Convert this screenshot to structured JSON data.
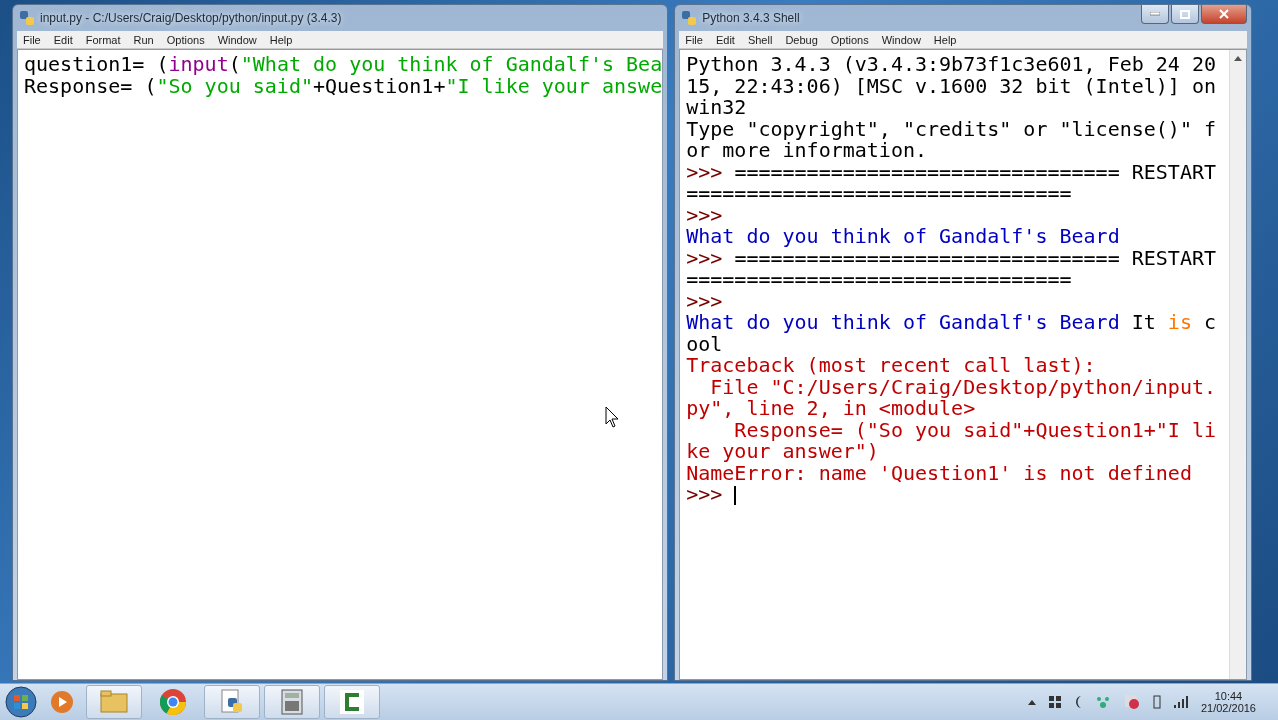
{
  "editor": {
    "title": "input.py - C:/Users/Craig/Desktop/python/input.py (3.4.3)",
    "menu": [
      "File",
      "Edit",
      "Format",
      "Run",
      "Options",
      "Window",
      "Help"
    ],
    "lines": [
      [
        {
          "text": "question1= (",
          "kind": "plain"
        },
        {
          "text": "input",
          "kind": "builtin"
        },
        {
          "text": "(",
          "kind": "plain"
        },
        {
          "text": "\"What do you think of Gandalf's Bea",
          "kind": "string"
        }
      ],
      [
        {
          "text": "Response= (",
          "kind": "plain"
        },
        {
          "text": "\"So you said\"",
          "kind": "string"
        },
        {
          "text": "+Question1+",
          "kind": "plain"
        },
        {
          "text": "\"I like your answe",
          "kind": "string"
        }
      ]
    ]
  },
  "shell": {
    "title": "Python 3.4.3 Shell",
    "menu": [
      "File",
      "Edit",
      "Shell",
      "Debug",
      "Options",
      "Window",
      "Help"
    ],
    "cursor": true,
    "lines": [
      [
        {
          "text": "Python 3.4.3 (v3.4.3:9b73f1c3e601, Feb 24 20",
          "kind": "plain"
        }
      ],
      [
        {
          "text": "15, 22:43:06) [MSC v.1600 32 bit (Intel)] on",
          "kind": "plain"
        }
      ],
      [
        {
          "text": "win32",
          "kind": "plain"
        }
      ],
      [
        {
          "text": "Type \"copyright\", \"credits\" or \"license()\" f",
          "kind": "plain"
        }
      ],
      [
        {
          "text": "or more information.",
          "kind": "plain"
        }
      ],
      [
        {
          "text": ">>> ",
          "kind": "prompt"
        },
        {
          "text": "================================ RESTART",
          "kind": "plain"
        }
      ],
      [
        {
          "text": "================================",
          "kind": "plain"
        }
      ],
      [
        {
          "text": ">>> ",
          "kind": "prompt"
        }
      ],
      [
        {
          "text": "What do you think of Gandalf's Beard",
          "kind": "output"
        }
      ],
      [
        {
          "text": ">>> ",
          "kind": "prompt"
        },
        {
          "text": "================================ RESTART",
          "kind": "plain"
        }
      ],
      [
        {
          "text": "================================",
          "kind": "plain"
        }
      ],
      [
        {
          "text": ">>> ",
          "kind": "prompt"
        }
      ],
      [
        {
          "text": "What do you think of Gandalf's Beard",
          "kind": "output"
        },
        {
          "text": " It ",
          "kind": "plain"
        },
        {
          "text": "is",
          "kind": "keyword"
        },
        {
          "text": " c",
          "kind": "plain"
        }
      ],
      [
        {
          "text": "ool",
          "kind": "plain"
        }
      ],
      [
        {
          "text": "Traceback (most recent call last):",
          "kind": "error"
        }
      ],
      [
        {
          "text": "  File \"C:/Users/Craig/Desktop/python/input.",
          "kind": "error"
        }
      ],
      [
        {
          "text": "py\", line 2, in <module>",
          "kind": "error"
        }
      ],
      [
        {
          "text": "    Response= (\"So you said\"+Question1+\"I li",
          "kind": "error"
        }
      ],
      [
        {
          "text": "ke your answer\")",
          "kind": "error"
        }
      ],
      [
        {
          "text": "NameError: name 'Question1' is not defined",
          "kind": "error"
        }
      ],
      [
        {
          "text": ">>> ",
          "kind": "prompt"
        }
      ]
    ]
  },
  "taskbar": {
    "clock": {
      "time": "10:44",
      "date": "21/02/2016"
    }
  }
}
